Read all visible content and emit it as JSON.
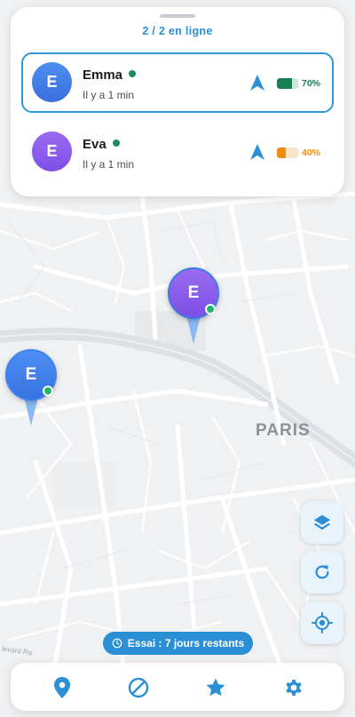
{
  "header": {
    "online_count": "2 / 2 en ligne"
  },
  "users": [
    {
      "initial": "E",
      "name": "Emma",
      "status": "Il y a 1 min",
      "battery_percent": 70,
      "battery_label": "70%",
      "battery_color": "#1a7f55",
      "battery_bg": "#cfe7da",
      "avatar_from": "#4d8ef0",
      "avatar_to": "#3a6fe0",
      "online": true
    },
    {
      "initial": "E",
      "name": "Eva",
      "status": "Il y a 1 min",
      "battery_percent": 40,
      "battery_label": "40%",
      "battery_color": "#f28c0f",
      "battery_bg": "#fde6c7",
      "avatar_from": "#9a6cf0",
      "avatar_to": "#7e4fe8",
      "online": true
    }
  ],
  "map": {
    "city_label": "PARIS",
    "street_label": "levard Ra",
    "markers": [
      {
        "initial": "E",
        "color": "#8a5cf0",
        "border": "#3b7be8"
      },
      {
        "initial": "E",
        "color": "#3a82ee",
        "border": "#3a82ee"
      }
    ]
  },
  "trial": {
    "label": "Essai : 7 jours restants"
  },
  "colors": {
    "accent": "#2b8fd6",
    "nav_arrow": "#2b8fd6",
    "online": "#1f8a5b"
  },
  "icons": {
    "layers": "layers-icon",
    "refresh": "refresh-icon",
    "locate": "crosshair-icon",
    "clock": "clock-icon",
    "nav_map": "map-pin-icon",
    "nav_block": "block-icon",
    "nav_fav": "star-icon",
    "nav_settings": "gear-icon"
  }
}
